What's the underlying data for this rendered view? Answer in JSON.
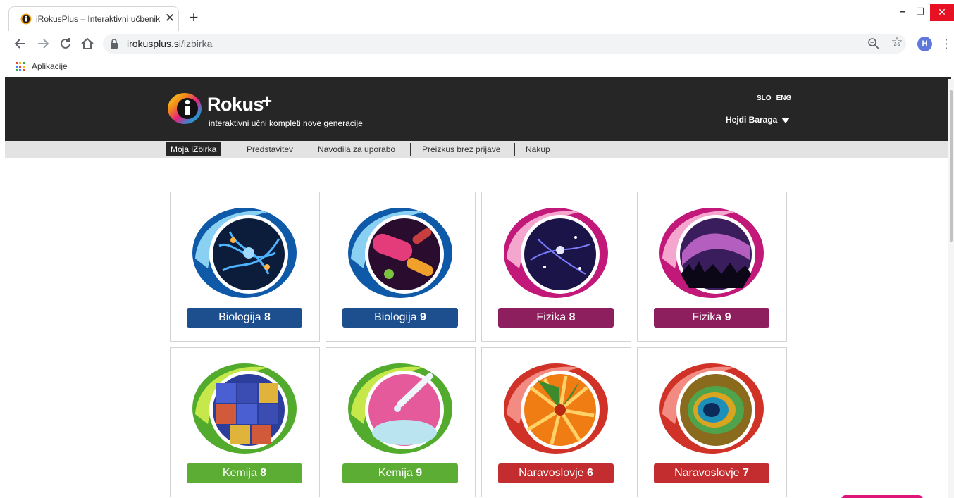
{
  "browser": {
    "tab_title": "iRokusPlus – Interaktivni učbenik",
    "tab_close": "✕",
    "new_tab": "+",
    "url_host": "irokusplus.si",
    "url_path": "/izbirka",
    "profile_initial": "H",
    "bookmark_apps_label": "Aplikacije",
    "window_controls": {
      "minimize": "–",
      "maximize": "❐",
      "close": "✕"
    },
    "icons": [
      "back-icon",
      "forward-icon",
      "reload-icon",
      "home-icon",
      "lock-icon",
      "zoom-icon",
      "star-icon",
      "menu-icon",
      "apps-icon"
    ]
  },
  "site": {
    "logo": {
      "name": "Rokus",
      "plus": "+",
      "tagline": "interaktivni učni kompleti nove generacije"
    },
    "lang": {
      "slo": "SLO",
      "eng": "ENG"
    },
    "user_name": "Hejdi Baraga",
    "nav": [
      {
        "label": "Moja iZbirka",
        "active": true
      },
      {
        "label": "Predstavitev",
        "active": false
      },
      {
        "label": "Navodila za uporabo",
        "active": false
      },
      {
        "label": "Preizkus brez prijave",
        "active": false
      },
      {
        "label": "Nakup",
        "active": false
      }
    ],
    "courses": [
      {
        "subject": "Biologija",
        "grade": "8",
        "color": "#1d4f8f",
        "ring": "#0f5aa8",
        "theme": "neurons"
      },
      {
        "subject": "Biologija",
        "grade": "9",
        "color": "#1d4f8f",
        "ring": "#0f5aa8",
        "theme": "bacteria"
      },
      {
        "subject": "Fizika",
        "grade": "8",
        "color": "#8e1f5e",
        "ring": "#c2187a",
        "theme": "galaxy"
      },
      {
        "subject": "Fizika",
        "grade": "9",
        "color": "#8e1f5e",
        "ring": "#c2187a",
        "theme": "aurora"
      },
      {
        "subject": "Kemija",
        "grade": "8",
        "color": "#5cad34",
        "ring": "#52ab2d",
        "theme": "periodic-table"
      },
      {
        "subject": "Kemija",
        "grade": "9",
        "color": "#5cad34",
        "ring": "#52ab2d",
        "theme": "pipette"
      },
      {
        "subject": "Naravoslovje",
        "grade": "6",
        "color": "#c42d2f",
        "ring": "#d03227",
        "theme": "flower"
      },
      {
        "subject": "Naravoslovje",
        "grade": "7",
        "color": "#c42d2f",
        "ring": "#d03227",
        "theme": "peacock"
      }
    ]
  }
}
